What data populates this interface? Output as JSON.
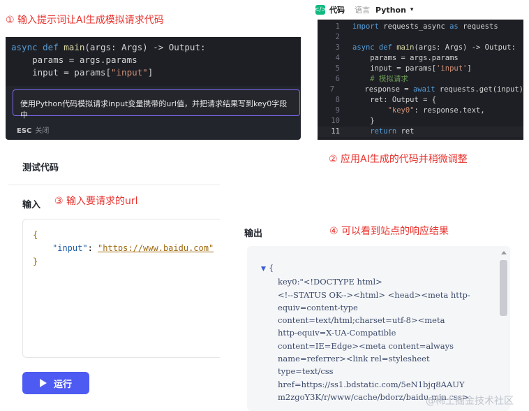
{
  "annotations": {
    "a1": "① 输入提示词让AI生成模拟请求代码",
    "a2": "② 应用AI生成的代码并稍微调整",
    "a3": "③ 输入要请求的url",
    "a4": "④ 可以看到站点的响应结果"
  },
  "ai_panel": {
    "lines": [
      {
        "kw": "async def ",
        "fn": "main",
        "rest": "(args: Args) -> Output:"
      },
      {
        "text": "    params = args.params"
      },
      {
        "pre": "    input = params[",
        "str": "\"input\"",
        "post": "]"
      }
    ],
    "prompt": "使用Python代码模拟请求input变量携带的url值，并把请求结果写到key0字段中",
    "esc_key": "ESC",
    "esc_label": "关闭"
  },
  "editor": {
    "badge": "</>",
    "title": "代码",
    "lang_label": "语言",
    "language": "Python",
    "caret": "▾",
    "lines": [
      {
        "n": "1",
        "segs": [
          {
            "c": "kw",
            "t": "import"
          },
          {
            "c": "",
            "t": " requests_async "
          },
          {
            "c": "kw",
            "t": "as"
          },
          {
            "c": "",
            "t": " requests"
          }
        ]
      },
      {
        "n": "2",
        "segs": []
      },
      {
        "n": "3",
        "segs": [
          {
            "c": "kw",
            "t": "async def "
          },
          {
            "c": "fn",
            "t": "main"
          },
          {
            "c": "",
            "t": "(args: Args) -> Output:"
          }
        ]
      },
      {
        "n": "4",
        "segs": [
          {
            "c": "",
            "t": "    params = args.params"
          }
        ]
      },
      {
        "n": "5",
        "segs": [
          {
            "c": "",
            "t": "    input = params["
          },
          {
            "c": "str",
            "t": "'input'"
          },
          {
            "c": "",
            "t": "]"
          }
        ]
      },
      {
        "n": "6",
        "segs": [
          {
            "c": "cm",
            "t": "    # 模拟请求"
          }
        ]
      },
      {
        "n": "7",
        "segs": [
          {
            "c": "",
            "t": "    response = "
          },
          {
            "c": "kw",
            "t": "await"
          },
          {
            "c": "",
            "t": " requests.get(input)"
          }
        ]
      },
      {
        "n": "8",
        "segs": [
          {
            "c": "",
            "t": "    ret: Output = {"
          }
        ]
      },
      {
        "n": "9",
        "segs": [
          {
            "c": "str",
            "t": "        \"key0\""
          },
          {
            "c": "",
            "t": ": response.text,"
          }
        ]
      },
      {
        "n": "10",
        "segs": [
          {
            "c": "",
            "t": "    }"
          }
        ]
      },
      {
        "n": "11",
        "segs": [
          {
            "c": "kw",
            "t": "    return"
          },
          {
            "c": "",
            "t": " ret"
          }
        ],
        "active": true
      }
    ]
  },
  "test": {
    "title": "测试代码",
    "input_label": "输入",
    "json_open": "{",
    "json_key": "\"input\"",
    "json_sep": ": ",
    "json_value": "\"https://www.baidu.com\"",
    "json_close": "}",
    "run_label": "运行"
  },
  "output": {
    "label": "输出",
    "open": "{",
    "lines": [
      "key0:\"<!DOCTYPE html>",
      "<!--STATUS OK--><html> <head><meta http-",
      "equiv=content-type",
      "content=text/html;charset=utf-8><meta",
      "http-equiv=X-UA-Compatible",
      "content=IE=Edge><meta content=always",
      "name=referrer><link rel=stylesheet",
      "type=text/css",
      "href=https://ss1.bdstatic.com/5eN1bjq8AAUY",
      "m2zgoY3K/r/www/cache/bdorz/baidu.min.css>"
    ]
  },
  "watermark": "@稀土掘金技术社区"
}
